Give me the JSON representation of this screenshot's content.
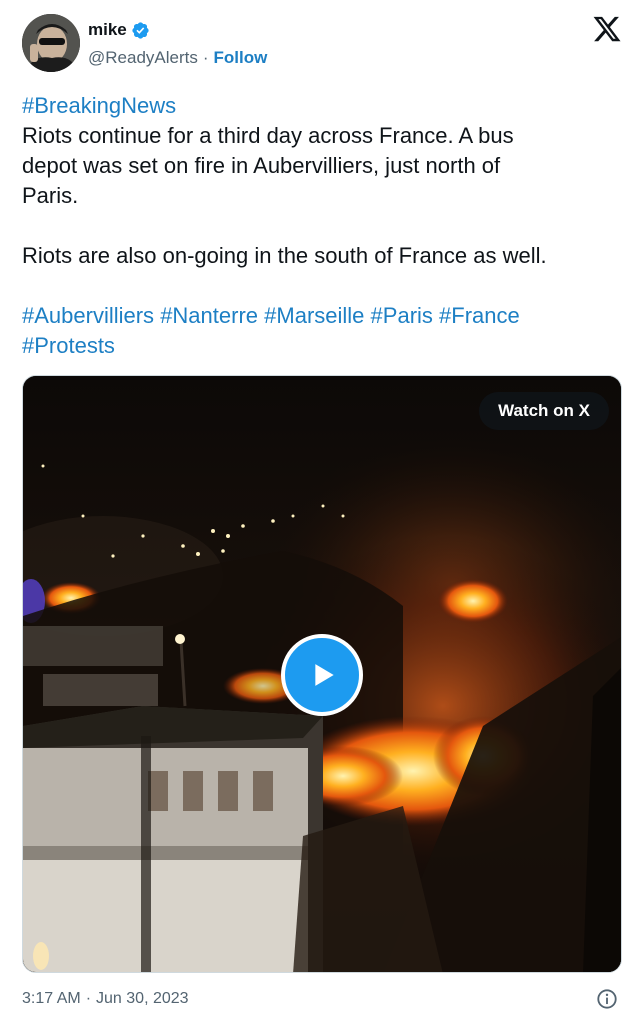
{
  "author": {
    "name": "mike",
    "handle": "@ReadyAlerts",
    "follow_label": "Follow",
    "verified_color": "#1d9bf0",
    "avatar_icon": "profile-photo"
  },
  "tweet": {
    "lines": [
      {
        "text": "#BreakingNews",
        "hashtag": true
      },
      {
        "text": "Riots continue for a third day across France. A bus",
        "hashtag": false
      },
      {
        "text": "depot was set on fire in Aubervilliers, just north of",
        "hashtag": false
      },
      {
        "text": "Paris.",
        "hashtag": false
      }
    ],
    "paragraph2": "Riots are also on-going in the south of France as well.",
    "hashtags_line1": [
      "#Aubervilliers",
      "#Nanterre",
      "#Marseille",
      "#Paris",
      "#France"
    ],
    "hashtags_line2": [
      "#Protests"
    ]
  },
  "media": {
    "watch_label": "Watch on X",
    "play_icon": "play-icon"
  },
  "footer": {
    "time": "3:17 AM",
    "date": "Jun 30, 2023",
    "info_icon": "info-icon"
  },
  "colors": {
    "link": "#1d7fc4",
    "text": "#0f1419",
    "muted": "#536471",
    "play": "#1d9bf0"
  }
}
